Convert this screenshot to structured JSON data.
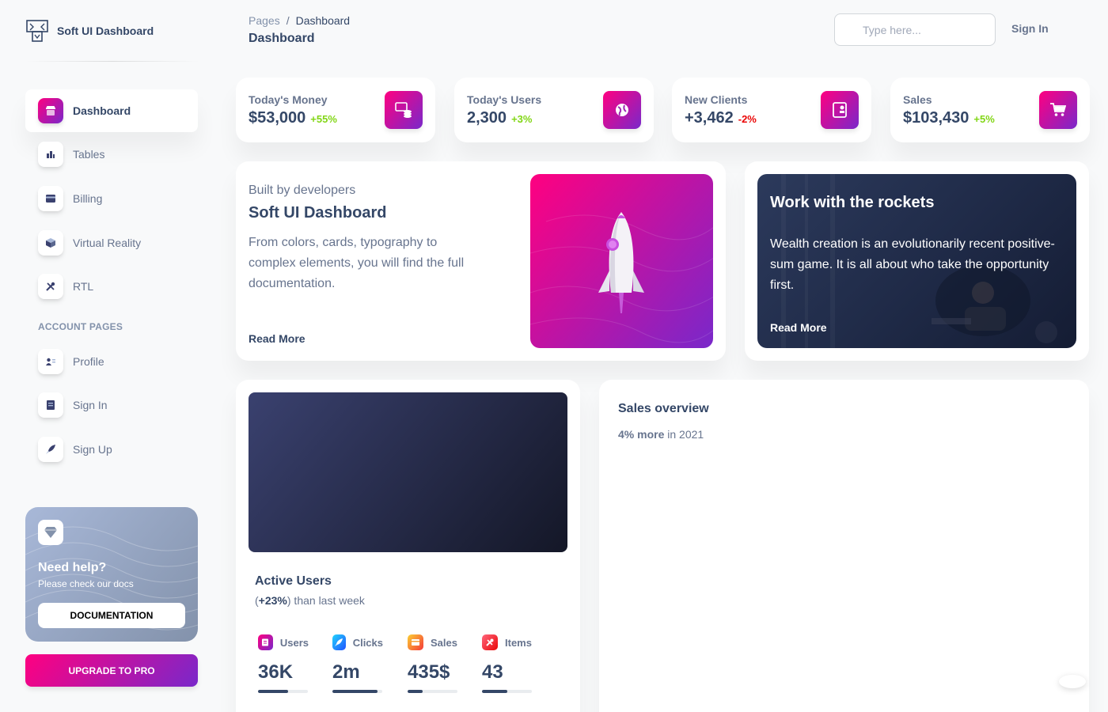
{
  "sidebar": {
    "brand": "Soft UI Dashboard",
    "items": [
      {
        "label": "Dashboard"
      },
      {
        "label": "Tables"
      },
      {
        "label": "Billing"
      },
      {
        "label": "Virtual Reality"
      },
      {
        "label": "RTL"
      }
    ],
    "section_title": "ACCOUNT PAGES",
    "account_items": [
      {
        "label": "Profile"
      },
      {
        "label": "Sign In"
      },
      {
        "label": "Sign Up"
      }
    ],
    "help": {
      "title": "Need help?",
      "subtitle": "Please check our docs",
      "button": "DOCUMENTATION"
    },
    "upgrade_button": "UPGRADE TO PRO"
  },
  "header": {
    "breadcrumb_root": "Pages",
    "breadcrumb_sep": "/",
    "breadcrumb_current": "Dashboard",
    "title": "Dashboard",
    "search_placeholder": "Type here...",
    "sign_in": "Sign In"
  },
  "stats": [
    {
      "label": "Today's Money",
      "value": "$53,000",
      "change": "+55%",
      "change_color": "#82d616"
    },
    {
      "label": "Today's Users",
      "value": "2,300",
      "change": "+3%",
      "change_color": "#82d616"
    },
    {
      "label": "New Clients",
      "value": "+3,462",
      "change": "-2%",
      "change_color": "#ea0606"
    },
    {
      "label": "Sales",
      "value": "$103,430",
      "change": "+5%",
      "change_color": "#82d616"
    }
  ],
  "developers": {
    "eyebrow": "Built by developers",
    "title": "Soft UI Dashboard",
    "description": "From colors, cards, typography to complex elements, you will find the full documentation.",
    "read_more": "Read More"
  },
  "rockets": {
    "title": "Work with the rockets",
    "description": "Wealth creation is an evolutionarily recent positive-sum game. It is all about who take the opportunity first.",
    "read_more": "Read More"
  },
  "active_users": {
    "title": "Active Users",
    "change": "+23%",
    "subtitle_suffix": " than last week",
    "metrics": [
      {
        "label": "Users",
        "value": "36K",
        "progress": 0.6,
        "icon": "document-icon",
        "color": "#cb0c9f"
      },
      {
        "label": "Clicks",
        "value": "2m",
        "progress": 0.9,
        "icon": "rocket-icon",
        "color": "#17c1e8"
      },
      {
        "label": "Sales",
        "value": "435$",
        "progress": 0.3,
        "icon": "card-icon",
        "color": "#fbcf33"
      },
      {
        "label": "Items",
        "value": "43",
        "progress": 0.5,
        "icon": "tools-icon",
        "color": "#ea0606"
      }
    ]
  },
  "sales_overview": {
    "title": "Sales overview",
    "highlight": "4% more",
    "suffix": " in 2021"
  }
}
